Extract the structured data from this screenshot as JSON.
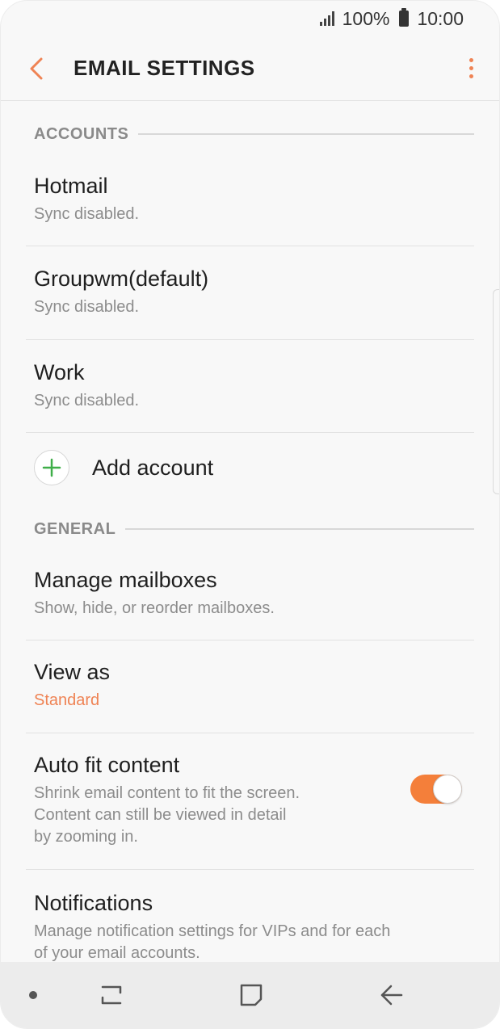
{
  "status_bar": {
    "battery_text": "100%",
    "time": "10:00"
  },
  "app_bar": {
    "title": "EMAIL SETTINGS",
    "back_icon": "back-arrow-icon",
    "more_icon": "more-vertical-icon"
  },
  "sections": {
    "accounts": {
      "header": "ACCOUNTS",
      "items": [
        {
          "title": "Hotmail",
          "subtitle": "Sync disabled."
        },
        {
          "title": "Groupwm(default)",
          "subtitle": "Sync disabled."
        },
        {
          "title": "Work",
          "subtitle": "Sync disabled."
        }
      ],
      "add_label": "Add account"
    },
    "general": {
      "header": "GENERAL",
      "manage_mailboxes": {
        "title": "Manage mailboxes",
        "subtitle": "Show, hide, or reorder mailboxes."
      },
      "view_as": {
        "title": "View as",
        "value": "Standard"
      },
      "auto_fit": {
        "title": "Auto fit content",
        "line1": "Shrink email content to fit the screen.",
        "line2": "Content can still be viewed in detail",
        "line3": "by zooming in.",
        "enabled": true
      },
      "notifications": {
        "title": "Notifications",
        "line1": "Manage notification settings for VIPs and for each",
        "line2": "of your email accounts."
      }
    }
  },
  "colors": {
    "accent": "#ef8354",
    "toggle_on": "#f47f3a",
    "add_green": "#3fae49"
  },
  "nav_bar": {
    "icons": [
      "dot-icon",
      "recent-apps-icon",
      "home-icon",
      "back-icon"
    ]
  }
}
